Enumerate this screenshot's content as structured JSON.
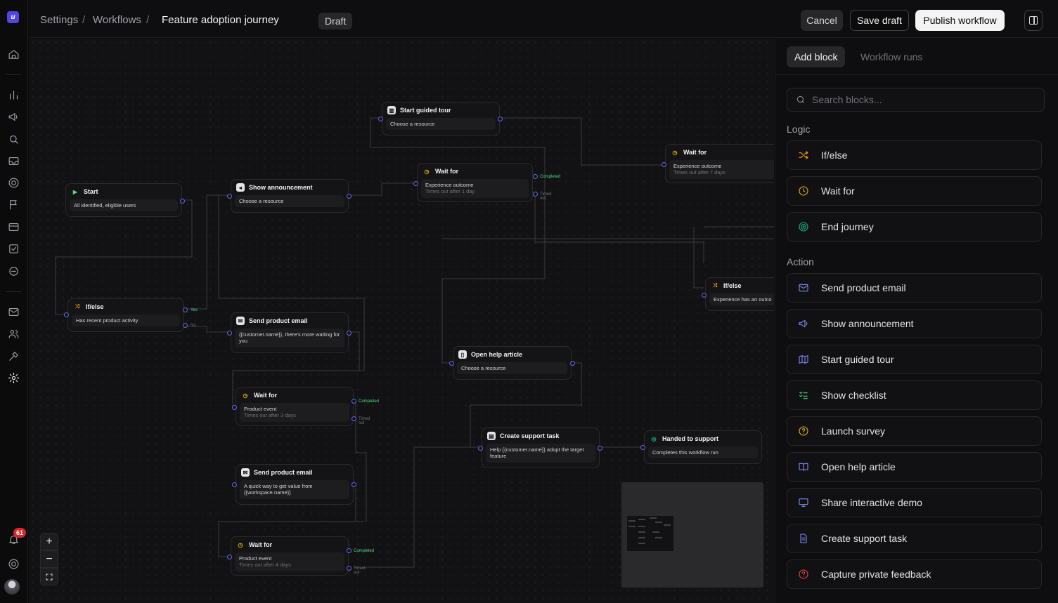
{
  "breadcrumb": {
    "settings": "Settings",
    "workflows": "Workflows",
    "title": "Feature adoption journey",
    "sep": "/"
  },
  "status": "Draft",
  "header": {
    "cancel": "Cancel",
    "save_draft": "Save draft",
    "publish": "Publish workflow"
  },
  "notifications_count": "61",
  "logo_letter": "u",
  "zoom": {
    "in": "+",
    "out": "−"
  },
  "nodes": {
    "start": {
      "title": "Start",
      "body": "All identified, eligible users"
    },
    "ifelse1": {
      "title": "If/else",
      "body": "Has recent product activity",
      "yes": "Yes",
      "no": "No"
    },
    "announce": {
      "title": "Show announcement",
      "body": "Choose a resource"
    },
    "tour": {
      "title": "Start guided tour",
      "body": "Choose a resource"
    },
    "wait1": {
      "title": "Wait for",
      "body": "Experience outcome",
      "sub": "Times out after 1 day",
      "completed": "Completed",
      "timed": "Timed out"
    },
    "wait2": {
      "title": "Wait for",
      "body": "Experience outcome",
      "sub": "Times out after 7 days"
    },
    "ifelse2": {
      "title": "If/else",
      "body": "Experience has an outco"
    },
    "email1": {
      "title": "Send product email",
      "body": "{{customer.name}}, there's more waiting for you"
    },
    "wait3": {
      "title": "Wait for",
      "body": "Product event",
      "sub": "Times out after 3 days",
      "completed": "Completed",
      "timed": "Timed out"
    },
    "email2": {
      "title": "Send product email",
      "body": "A quick way to get value from {{workspace.name}}"
    },
    "wait4": {
      "title": "Wait for",
      "body": "Product event",
      "sub": "Times out after 4 days",
      "completed": "Completed",
      "timed": "Timed out"
    },
    "help": {
      "title": "Open help article",
      "body": "Choose a resource"
    },
    "support": {
      "title": "Create support task",
      "body": "Help {{customer.name}} adopt the target feature"
    },
    "handed": {
      "title": "Handed to support",
      "body": "Completes this workflow run"
    }
  },
  "panel": {
    "tab_add": "Add block",
    "tab_runs": "Workflow runs",
    "search_placeholder": "Search blocks...",
    "logic_label": "Logic",
    "action_label": "Action",
    "logic": [
      {
        "label": "If/else",
        "icon": "shuffle-icon",
        "color": "#f59e0b"
      },
      {
        "label": "Wait for",
        "icon": "clock-icon",
        "color": "#eab308"
      },
      {
        "label": "End journey",
        "icon": "target-icon",
        "color": "#10b981"
      }
    ],
    "action": [
      {
        "label": "Send product email",
        "icon": "mail-icon",
        "color": "#818cf8"
      },
      {
        "label": "Show announcement",
        "icon": "megaphone-icon",
        "color": "#818cf8"
      },
      {
        "label": "Start guided tour",
        "icon": "map-icon",
        "color": "#818cf8"
      },
      {
        "label": "Show checklist",
        "icon": "checklist-icon",
        "color": "#4ade80"
      },
      {
        "label": "Launch survey",
        "icon": "question-icon",
        "color": "#eab308"
      },
      {
        "label": "Open help article",
        "icon": "book-icon",
        "color": "#818cf8"
      },
      {
        "label": "Share interactive demo",
        "icon": "monitor-icon",
        "color": "#818cf8"
      },
      {
        "label": "Create support task",
        "icon": "file-icon",
        "color": "#818cf8"
      },
      {
        "label": "Capture private feedback",
        "icon": "feedback-icon",
        "color": "#ef4444"
      }
    ]
  }
}
